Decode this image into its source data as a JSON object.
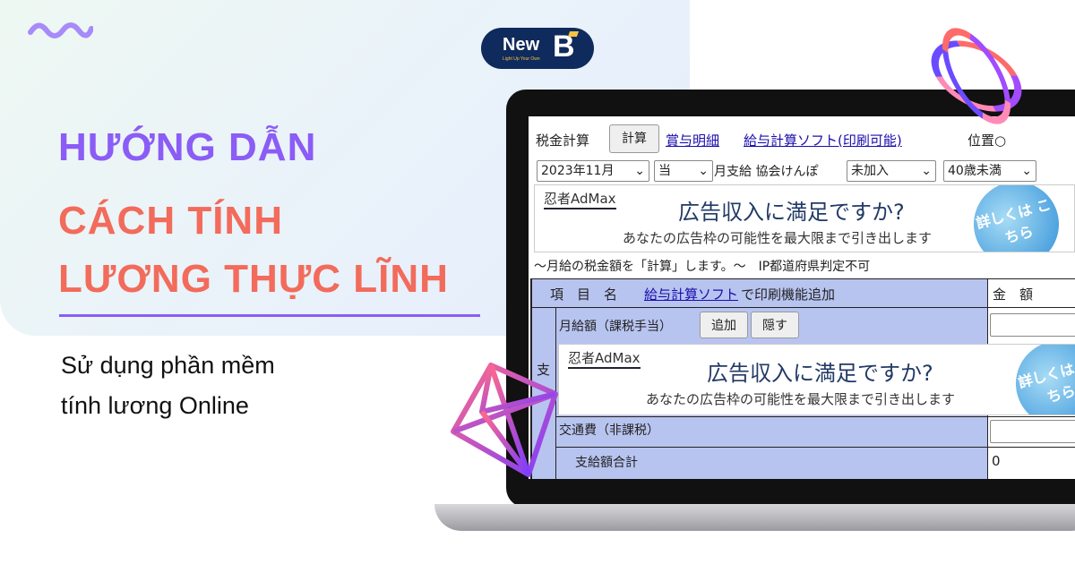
{
  "banner": {
    "logo": {
      "name": "New B",
      "tagline": "Light Up Your Own"
    },
    "title_line1": "HƯỚNG DẪN",
    "title_line2": "CÁCH TÍNH",
    "title_line3": "LƯƠNG THỰC LĨNH",
    "subtitle_line1": "Sử dụng phần mềm",
    "subtitle_line2": "tính lương Online",
    "colors": {
      "purple": "#8b5cf6",
      "coral": "#f26b5b",
      "navy": "#0f2a5c"
    }
  },
  "app": {
    "header_label": "税金計算",
    "calc_button": "計算",
    "link_bonus": "賞与明細",
    "link_software": "給与計算ソフト(印刷可能)",
    "position_label": "位置○",
    "month_select": "2023年11月",
    "pay_select": "当",
    "pay_suffix": "月支給 協会けんぽ",
    "insurance_select": "未加入",
    "age_select": "40歳未満",
    "ad": {
      "brand": "忍者AdMax",
      "headline": "広告収入に満足ですか?",
      "desc": "あなたの広告枠の可能性を最大限まで引き出します",
      "cta": "詳しくは こちら"
    },
    "info_text": "〜月給の税金額を「計算」します。〜　IP都道府県判定不可",
    "table": {
      "col_item": "項　目　名",
      "col_item_link": "給与計算ソフト",
      "col_item_suffix": "で印刷機能追加",
      "col_amount": "金　額",
      "side_label": "支",
      "row_salary": "月給額（課税手当）",
      "add_button": "追加",
      "hide_button": "隠す",
      "row_transport": "交通費（非課税）",
      "row_total": "支給額合計",
      "total_value": "0"
    }
  }
}
